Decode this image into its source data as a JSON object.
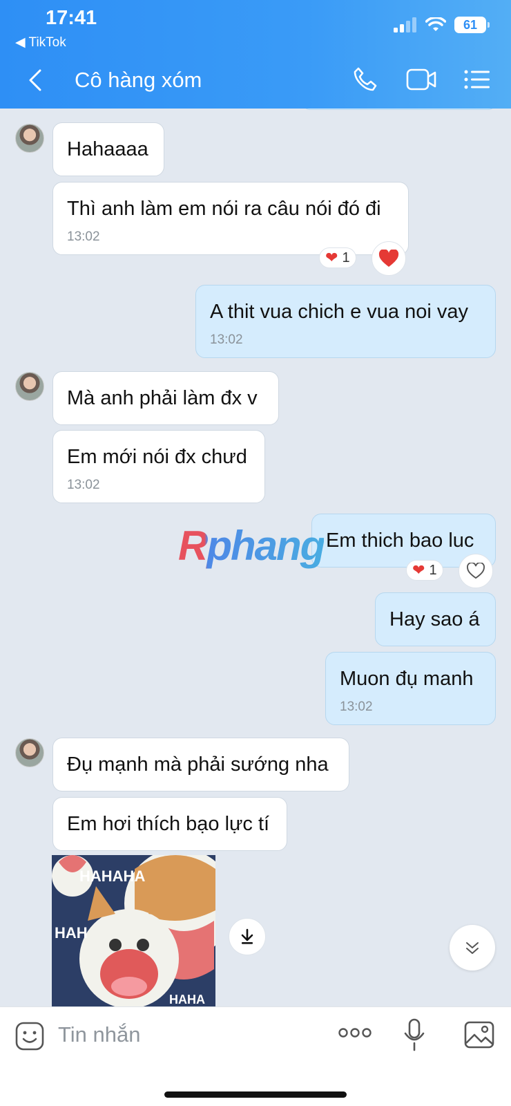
{
  "status_bar": {
    "time": "17:41",
    "back_app": "◀ TikTok",
    "battery": "61"
  },
  "header": {
    "title": "Cô hàng xóm"
  },
  "colors": {
    "header_blue": "#2e8ff5",
    "incoming_bubble": "#ffffff",
    "outgoing_bubble": "#d5ecfd",
    "heart_red": "#e53935"
  },
  "messages": [
    {
      "dir": "in",
      "text": "Hahaaaa",
      "time": ""
    },
    {
      "dir": "in",
      "text": "Thì anh làm em nói ra câu nói đó đi",
      "time": "13:02",
      "reaction": {
        "emoji": "❤",
        "count": "1"
      }
    },
    {
      "dir": "out",
      "text": "A thit vua chich e vua noi vay",
      "time": "13:02"
    },
    {
      "dir": "in",
      "text": "Mà anh phải làm đx v",
      "time": ""
    },
    {
      "dir": "in",
      "text": "Em mới nói đx chưd",
      "time": "13:02"
    },
    {
      "dir": "out",
      "text": "Em thich bao luc",
      "time": "",
      "reaction": {
        "emoji": "❤",
        "count": "1"
      }
    },
    {
      "dir": "out",
      "text": "Hay sao á",
      "time": ""
    },
    {
      "dir": "out",
      "text": "Muon đụ manh",
      "time": "13:02"
    },
    {
      "dir": "in",
      "text": "Đụ mạnh mà phải sướng nha",
      "time": ""
    },
    {
      "dir": "in",
      "text": "Em hơi thích bạo lực tí",
      "time": ""
    }
  ],
  "sticker": {
    "text": "HAHAHA",
    "text2": "HAHA",
    "text3": "HAH"
  },
  "watermark": {
    "text": "Rphang"
  },
  "input": {
    "placeholder": "Tin nhắn"
  }
}
